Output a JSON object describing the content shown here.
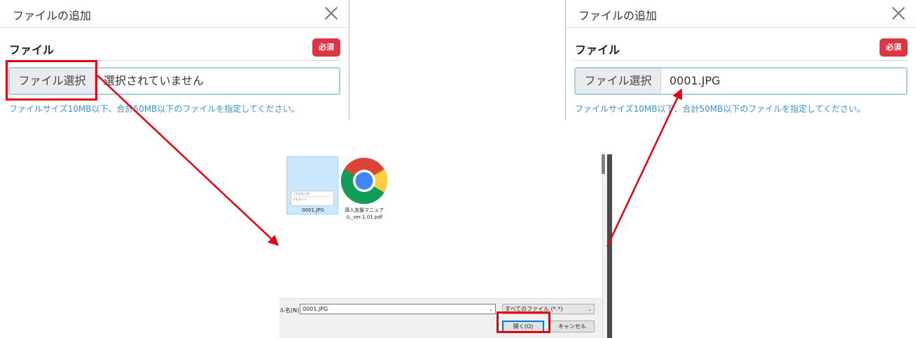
{
  "left_modal": {
    "title": "ファイルの追加",
    "field_label": "ファイル",
    "required_badge": "必須",
    "file_button": "ファイル選択",
    "file_value": "選択されていません",
    "help_text": "ファイルサイズ10MB以下、合計50MB以下のファイルを指定してください。"
  },
  "right_modal": {
    "title": "ファイルの追加",
    "field_label": "ファイル",
    "required_badge": "必須",
    "file_button": "ファイル選択",
    "file_value": "0001.JPG",
    "help_text": "ファイルサイズ10MB以下、合計50MB以下のファイルを指定してください。"
  },
  "dialog": {
    "files": [
      {
        "name": "0001.JPG",
        "selected": true,
        "thumb_line1": "ご利用案内票",
        "thumb_line2": "デモサイト"
      },
      {
        "name_line1": "導入支援マニュア",
        "name_line2": "ル_ver.1.01.pdf",
        "icon": "chrome-icon"
      }
    ],
    "filename_label": "ル名(N):",
    "filename_value": "0001.JPG",
    "filetype_value": "すべてのファイル (*.*)",
    "open_button": "開く(O)",
    "cancel_button": "キャンセル"
  },
  "colors": {
    "highlight": "#e60012",
    "badge": "#dc3545",
    "help_text": "#3a8fd1",
    "selection": "#cce8ff"
  }
}
